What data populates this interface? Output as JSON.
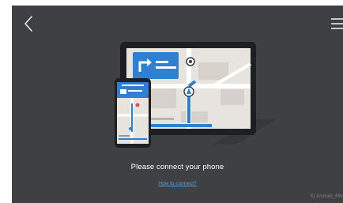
{
  "screen": {
    "message": "Please connect your phone",
    "help_link": "How to connect?",
    "watermark": "ID:Android_6ffe"
  },
  "icons": {
    "back": "chevron-left-icon",
    "menu": "hamburger-menu-icon"
  },
  "colors": {
    "background": "#3e4043",
    "link": "#5a9fd8",
    "nav_blue": "#2f7fd2",
    "map_bg": "#e7e4df"
  }
}
